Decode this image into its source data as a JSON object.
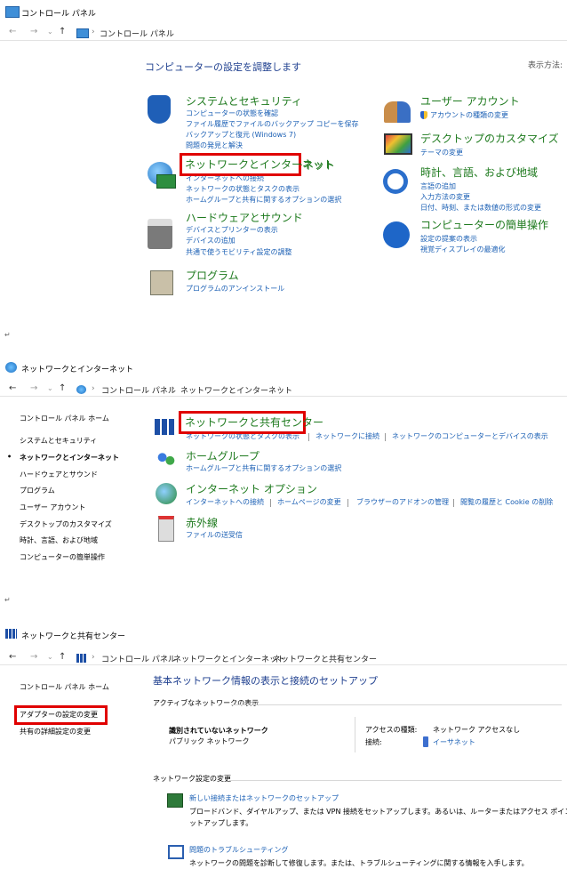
{
  "panel1": {
    "window_title": "コントロール パネル",
    "breadcrumb": [
      "コントロール パネル"
    ],
    "heading": "コンピューターの設定を調整します",
    "view_by": "表示方法:",
    "categories_left": [
      {
        "title": "システムとセキュリティ",
        "links": [
          "コンピューターの状態を確認",
          "ファイル履歴でファイルのバックアップ コピーを保存",
          "バックアップと復元 (Windows 7)",
          "問題の発見と解決"
        ]
      },
      {
        "title": "ネットワークとインターネット",
        "links": [
          "インターネットへの接続",
          "ネットワークの状態とタスクの表示",
          "ホームグループと共有に関するオプションの選択"
        ]
      },
      {
        "title": "ハードウェアとサウンド",
        "links": [
          "デバイスとプリンターの表示",
          "デバイスの追加",
          "共通で使うモビリティ設定の調整"
        ]
      },
      {
        "title": "プログラム",
        "links": [
          "プログラムのアンインストール"
        ]
      }
    ],
    "categories_right": [
      {
        "title": "ユーザー アカウント",
        "links": [
          "アカウントの種類の変更"
        ]
      },
      {
        "title": "デスクトップのカスタマイズ",
        "links": [
          "テーマの変更"
        ]
      },
      {
        "title": "時計、言語、および地域",
        "links": [
          "言語の追加",
          "入力方法の変更",
          "日付、時刻、または数値の形式の変更"
        ]
      },
      {
        "title": "コンピューターの簡単操作",
        "links": [
          "設定の提案の表示",
          "視覚ディスプレイの最適化"
        ]
      }
    ]
  },
  "para_mark": "↵",
  "panel2": {
    "window_title": "ネットワークとインターネット",
    "breadcrumb": [
      "コントロール パネル",
      "ネットワークとインターネット"
    ],
    "sidebar": [
      "コントロール パネル ホーム",
      "システムとセキュリティ",
      "ネットワークとインターネット",
      "ハードウェアとサウンド",
      "プログラム",
      "ユーザー アカウント",
      "デスクトップのカスタマイズ",
      "時計、言語、および地域",
      "コンピューターの簡単操作"
    ],
    "items": [
      {
        "title": "ネットワークと共有センター",
        "links": [
          "ネットワークの状態とタスクの表示",
          "ネットワークに接続",
          "ネットワークのコンピューターとデバイスの表示"
        ]
      },
      {
        "title": "ホームグループ",
        "links": [
          "ホームグループと共有に関するオプションの選択"
        ]
      },
      {
        "title": "インターネット オプション",
        "links": [
          "インターネットへの接続",
          "ホームページの変更",
          "ブラウザーのアドオンの管理",
          "閲覧の履歴と Cookie の削除"
        ]
      },
      {
        "title": "赤外線",
        "links": [
          "ファイルの送受信"
        ]
      }
    ]
  },
  "panel3": {
    "window_title": "ネットワークと共有センター",
    "breadcrumb": [
      "コントロール パネル",
      "ネットワークとインターネット",
      "ネットワークと共有センター"
    ],
    "sidebar": [
      "コントロール パネル ホーム",
      "アダプターの設定の変更",
      "共有の詳細設定の変更"
    ],
    "heading": "基本ネットワーク情報の表示と接続のセットアップ",
    "active_networks_label": "アクティブなネットワークの表示",
    "network_name": "識別されていないネットワーク",
    "network_type": "パブリック ネットワーク",
    "access_type_label": "アクセスの種類:",
    "access_type_value": "ネットワーク アクセスなし",
    "connection_label": "接続:",
    "connection_value": "イーサネット",
    "change_settings_label": "ネットワーク設定の変更",
    "new_connection_title": "新しい接続またはネットワークのセットアップ",
    "new_connection_desc_1": "ブロードバンド、ダイヤルアップ、または VPN 接続をセットアップします。あるいは、ルーターまたはアクセス ポイントをセ",
    "new_connection_desc_2": "ットアップします。",
    "troubleshoot_title": "問題のトラブルシューティング",
    "troubleshoot_desc": "ネットワークの問題を診断して修復します。または、トラブルシューティングに関する情報を入手します。"
  },
  "colors": {
    "highlight": "#e00000",
    "link": "#1a5fb4",
    "category": "#1e7a1e"
  }
}
